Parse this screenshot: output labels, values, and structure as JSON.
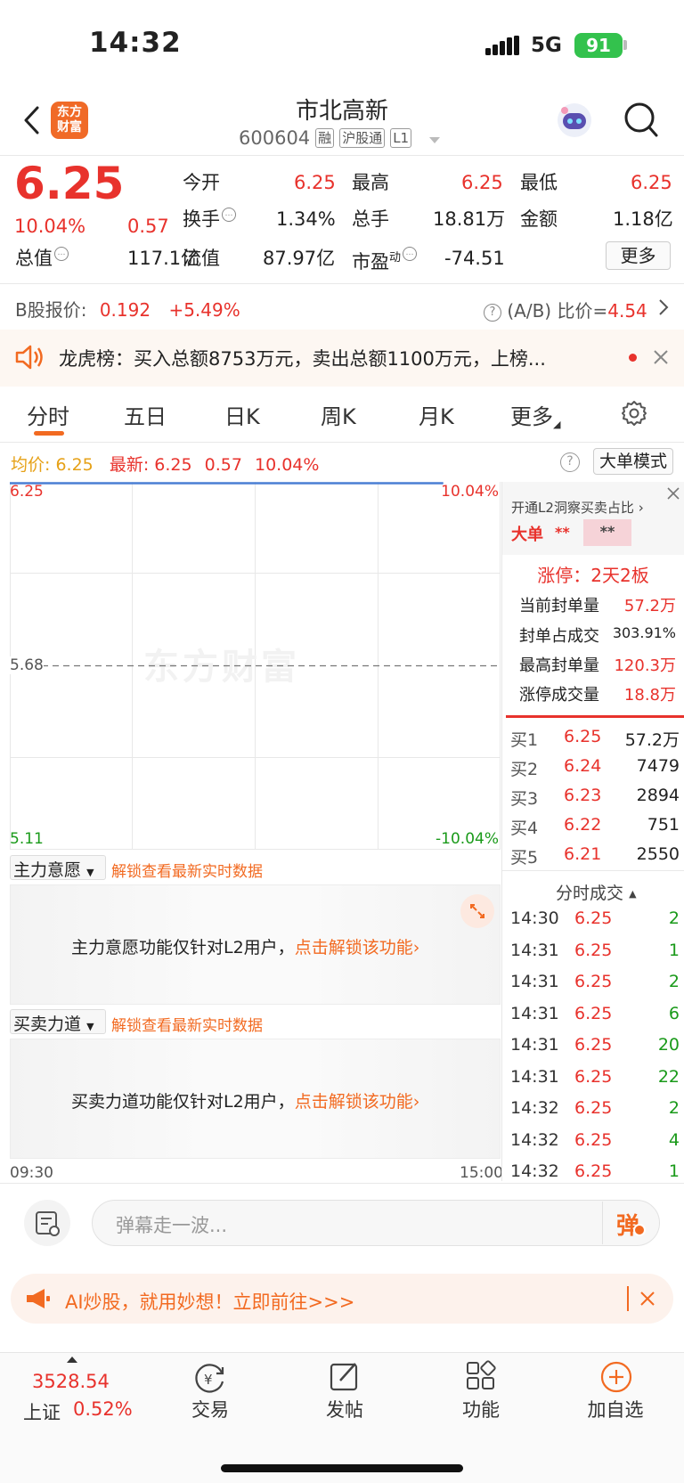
{
  "status_bar": {
    "time": "14:32",
    "network": "5G",
    "battery": "91"
  },
  "header": {
    "logo_text_1": "东方",
    "logo_text_2": "财富",
    "title": "市北高新",
    "code": "600604",
    "tags": [
      "融",
      "沪股通",
      "L1"
    ]
  },
  "quote": {
    "price": "6.25",
    "change_pct": "10.04%",
    "change": "0.57",
    "total_value_label": "总值",
    "total_value": "117.1亿",
    "fields": [
      {
        "label": "今开",
        "value": "6.25"
      },
      {
        "label": "最高",
        "value": "6.25"
      },
      {
        "label": "最低",
        "value": "6.25"
      },
      {
        "label": "换手",
        "value": "1.34%"
      },
      {
        "label": "总手",
        "value": "18.81万"
      },
      {
        "label": "金额",
        "value": "1.18亿"
      },
      {
        "label": "流值",
        "value": "87.97亿"
      },
      {
        "label": "市盈",
        "sup": "动",
        "value": "-74.51"
      }
    ],
    "more_button": "更多"
  },
  "b_share": {
    "label": "B股报价:",
    "price": "0.192",
    "change": "+5.49%",
    "ratio_label": "(A/B) 比价=",
    "ratio": "4.54"
  },
  "notice": {
    "text": "龙虎榜：买入总额8753万元，卖出总额1100万元，上榜..."
  },
  "tabs": [
    "分时",
    "五日",
    "日K",
    "周K",
    "月K",
    "更多"
  ],
  "chart_info": {
    "avg_label": "均价:",
    "avg": "6.25",
    "latest_label": "最新:",
    "latest": "6.25",
    "latest_change": "0.57",
    "latest_pct": "10.04%",
    "mode_button": "大单模式"
  },
  "chart_data": {
    "type": "line",
    "y_labels": {
      "top": "6.25",
      "mid": "5.68",
      "bottom": "5.11"
    },
    "pct_labels": {
      "top": "10.04%",
      "bottom": "-10.04%"
    },
    "watermark": "东方财富",
    "x_labels": {
      "start": "09:30",
      "end": "15:00"
    },
    "ylim": [
      5.11,
      6.25
    ],
    "series": [
      {
        "x": [
          "09:30",
          "14:32"
        ],
        "values": [
          6.25,
          6.25
        ]
      }
    ]
  },
  "panels": [
    {
      "select": "主力意愿",
      "unlock": "解锁查看最新实时数据",
      "message": "主力意愿功能仅针对L2用户，",
      "link": "点击解锁该功能"
    },
    {
      "select": "买卖力道",
      "unlock": "解锁查看最新实时数据",
      "message": "买卖力道功能仅针对L2用户，",
      "link": "点击解锁该功能"
    }
  ],
  "l2_promo": {
    "title": "开通L2洞察买卖占比",
    "big_label": "大单",
    "stars1": "**",
    "stars2": "**"
  },
  "limit_up": {
    "title": "涨停：2天2板",
    "rows": [
      {
        "label": "当前封单量",
        "value": "57.2万"
      },
      {
        "label": "封单占成交",
        "value": "303.91%"
      },
      {
        "label": "最高封单量",
        "value": "120.3万"
      },
      {
        "label": "涨停成交量",
        "value": "18.8万"
      }
    ]
  },
  "order_book": [
    {
      "label": "买1",
      "price": "6.25",
      "volume": "57.2万"
    },
    {
      "label": "买2",
      "price": "6.24",
      "volume": "7479"
    },
    {
      "label": "买3",
      "price": "6.23",
      "volume": "2894"
    },
    {
      "label": "买4",
      "price": "6.22",
      "volume": "751"
    },
    {
      "label": "买5",
      "price": "6.21",
      "volume": "2550"
    }
  ],
  "ticks_title": "分时成交",
  "ticks": [
    {
      "time": "14:30",
      "price": "6.25",
      "vol": "2"
    },
    {
      "time": "14:31",
      "price": "6.25",
      "vol": "1"
    },
    {
      "time": "14:31",
      "price": "6.25",
      "vol": "2"
    },
    {
      "time": "14:31",
      "price": "6.25",
      "vol": "6"
    },
    {
      "time": "14:31",
      "price": "6.25",
      "vol": "20"
    },
    {
      "time": "14:31",
      "price": "6.25",
      "vol": "22"
    },
    {
      "time": "14:32",
      "price": "6.25",
      "vol": "2"
    },
    {
      "time": "14:32",
      "price": "6.25",
      "vol": "4"
    },
    {
      "time": "14:32",
      "price": "6.25",
      "vol": "1"
    }
  ],
  "comment": {
    "placeholder": "弹幕走一波...",
    "send": "弹"
  },
  "ai_banner": {
    "text": "AI炒股，就用妙想！立即前往>>>"
  },
  "bottom_nav": {
    "index_value": "3528.54",
    "index_name": "上证",
    "index_pct": "0.52%",
    "items": [
      "交易",
      "发帖",
      "功能",
      "加自选"
    ]
  },
  "colors": {
    "up": "#e8322c",
    "down": "#1a9a1a",
    "accent": "#f26a21",
    "avg": "#e6a117",
    "line": "#4a7fd4"
  }
}
